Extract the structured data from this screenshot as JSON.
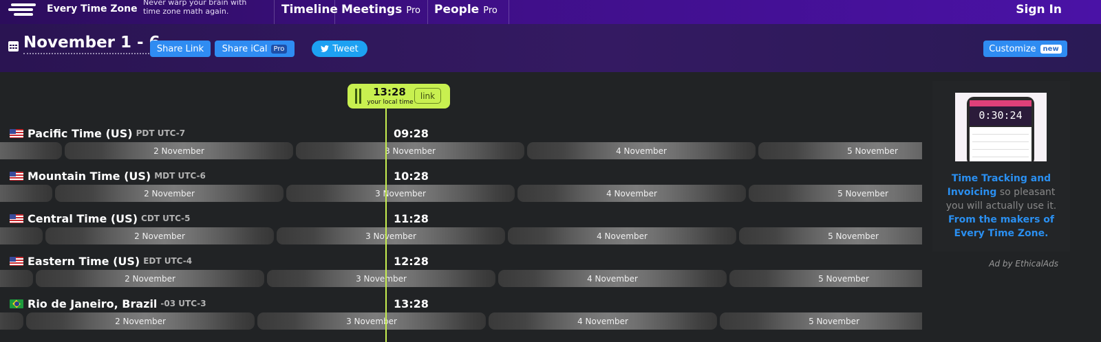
{
  "nav": {
    "brand": "Every Time Zone",
    "tagline": "Never warp your brain with time zone math again.",
    "links": [
      {
        "label": "Timeline",
        "badge": ""
      },
      {
        "label": "Meetings",
        "badge": "Pro"
      },
      {
        "label": "People",
        "badge": "Pro"
      }
    ],
    "signin": "Sign In"
  },
  "header": {
    "title": "November 1 - 6",
    "share_link": "Share Link",
    "share_ical": "Share iCal",
    "share_ical_badge": "Pro",
    "tweet": "Tweet",
    "customize": "Customize",
    "customize_badge": "new"
  },
  "local": {
    "time": "13:28",
    "label": "your local time",
    "link": "link"
  },
  "timezones": [
    {
      "name": "Pacific Time (US)",
      "abbr": "PDT UTC-7",
      "time": "09:28",
      "flag": "us",
      "days": [
        "2 November",
        "3 November",
        "4 November",
        "5 November"
      ]
    },
    {
      "name": "Mountain Time (US)",
      "abbr": "MDT UTC-6",
      "time": "10:28",
      "flag": "us",
      "days": [
        "2 November",
        "3 November",
        "4 November",
        "5 November"
      ]
    },
    {
      "name": "Central Time (US)",
      "abbr": "CDT UTC-5",
      "time": "11:28",
      "flag": "us",
      "days": [
        "2 November",
        "3 November",
        "4 November",
        "5 November"
      ]
    },
    {
      "name": "Eastern Time (US)",
      "abbr": "EDT UTC-4",
      "time": "12:28",
      "flag": "us",
      "days": [
        "2 November",
        "3 November",
        "4 November",
        "5 November"
      ]
    },
    {
      "name": "Rio de Janeiro, Brazil",
      "abbr": "-03 UTC-3",
      "time": "13:28",
      "flag": "br",
      "days": [
        "2 November",
        "3 November",
        "4 November",
        "5 November"
      ]
    }
  ],
  "ad": {
    "timer": "0:30:24",
    "text_hl1": "Time Tracking and Invoicing",
    "text_mid": " so pleasant you will actually use it. ",
    "text_hl2": "From the makers of Every Time Zone.",
    "credit": "Ad by EthicalAds"
  },
  "colors": {
    "nav_bg": "#3f0f88",
    "header_bg": "#2a1452",
    "accent_button": "#2f8cf2",
    "local_time_highlight": "#c8f050",
    "ad_link": "#2a8ff0"
  }
}
